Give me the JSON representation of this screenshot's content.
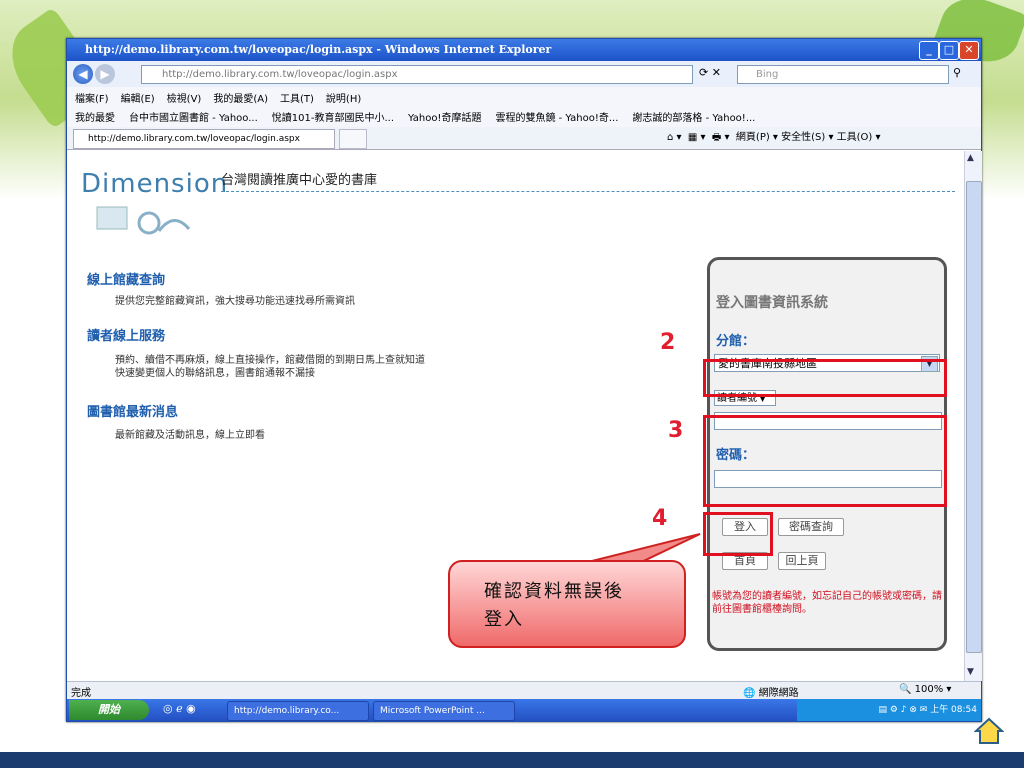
{
  "window": {
    "title": "http://demo.library.com.tw/loveopac/login.aspx - Windows Internet Explorer",
    "address": "http://demo.library.com.tw/loveopac/login.aspx",
    "search_placeholder": "Bing"
  },
  "menu": [
    "檔案(F)",
    "編輯(E)",
    "檢視(V)",
    "我的最愛(A)",
    "工具(T)",
    "說明(H)"
  ],
  "favorites": [
    "我的最愛",
    "台中市國立圖書館 - Yahoo...",
    "悅讀101-教育部國民中小...",
    "Yahoo!奇摩話題",
    "雲程的雙魚鏡 - Yahoo!奇...",
    "謝志誠的部落格 - Yahoo!..."
  ],
  "tab": {
    "label": "http://demo.library.com.tw/loveopac/login.aspx"
  },
  "commandbar": "網頁(P) ▾  安全性(S) ▾  工具(O) ▾",
  "page": {
    "logo": "Dimension",
    "site_title": "台灣閱讀推廣中心愛的書庫",
    "sections": [
      {
        "heading": "線上館藏查詢",
        "text": "提供您完整館藏資訊，強大搜尋功能迅速找尋所需資訊"
      },
      {
        "heading": "讀者線上服務",
        "text": "預約、續借不再麻煩，線上直接操作，館藏借閱的到期日馬上查就知道",
        "text2": "快速變更個人的聯絡訊息，圖書館通報不漏接"
      },
      {
        "heading": "圖書館最新消息",
        "text": "最新館藏及活動訊息，線上立即看"
      }
    ]
  },
  "login": {
    "title": "登入圖書資訊系統",
    "branch_label": "分館：",
    "branch_value": "愛的書庫南投縣地區",
    "id_type": "讀者編號",
    "password_label": "密碼：",
    "login_button": "登入",
    "password_query_button": "密碼查詢",
    "home_button": "首頁",
    "back_button": "回上頁",
    "note": "帳號為您的讀者編號，如忘記自己的帳號或密碼，請前往圖書館櫃檯詢問。"
  },
  "annotations": {
    "step2": "2",
    "step3": "3",
    "step4": "4",
    "callout_line1": "確認資料無誤後",
    "callout_line2": "登入"
  },
  "status": {
    "left": "完成",
    "zone": "網際網路",
    "zoom": "100%"
  },
  "taskbar": {
    "start": "開始",
    "tasks": [
      "http://demo.library.co...",
      "Microsoft PowerPoint ..."
    ],
    "clock": "上午 08:54"
  },
  "colors": {
    "accent": "#1f5fae",
    "annotation_red": "#e01020",
    "note_red": "#d01020"
  }
}
